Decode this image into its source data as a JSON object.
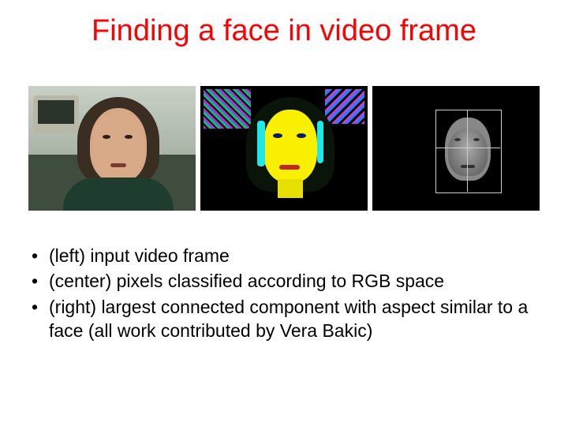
{
  "title": "Finding a face in video frame",
  "bullets": [
    "(left) input video frame",
    "(center) pixels classified according to RGB space",
    "(right) largest connected component with aspect similar to a face (all work contributed by Vera Bakic)"
  ],
  "images": {
    "left_alt": "input video frame of a person",
    "center_alt": "pixels classified by RGB color",
    "right_alt": "largest connected component with face aspect and bounding box"
  }
}
